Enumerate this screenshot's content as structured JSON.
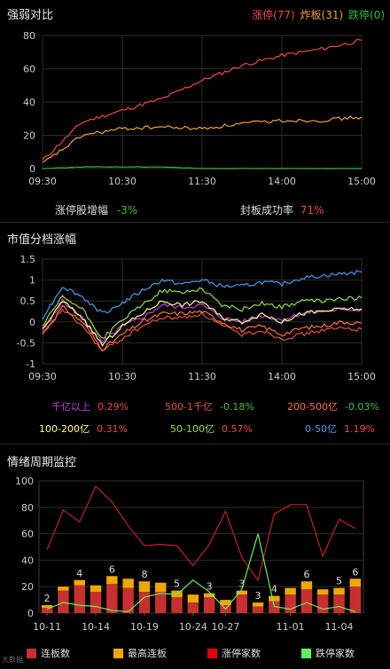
{
  "panel1": {
    "title": "强弱对比",
    "legend": {
      "limit_up": "涨停(77)",
      "bomb": "炸板(31)",
      "limit_down": "跌停(0)"
    },
    "yticks": [
      "80",
      "60",
      "40",
      "20",
      "0"
    ],
    "xticks": [
      "09:30",
      "10:30",
      "11:30",
      "14:00",
      "15:00"
    ],
    "stats": {
      "zt_label": "涨停股增幅",
      "zt_value": "-3%",
      "fb_label": "封板成功率",
      "fb_value": "71%"
    }
  },
  "panel2": {
    "title": "市值分档涨幅",
    "yticks": [
      "1.5",
      "1",
      "0.5",
      "0",
      "-0.5",
      "-1"
    ],
    "xticks": [
      "09:30",
      "10:30",
      "11:30",
      "14:00",
      "15:00"
    ],
    "captions": [
      {
        "label": "千亿以上",
        "value": "0.29%",
        "color": "#c040e0",
        "vcolor": "#f04848"
      },
      {
        "label": "500-1千亿",
        "value": "-0.18%",
        "color": "#e85040",
        "vcolor": "#40c040"
      },
      {
        "label": "200-500亿",
        "value": "-0.03%",
        "color": "#ff7040",
        "vcolor": "#40c040"
      },
      {
        "label": "100-200亿",
        "value": "0.31%",
        "color": "#ffff80",
        "vcolor": "#f04848"
      },
      {
        "label": "50-100亿",
        "value": "0.57%",
        "color": "#90e040",
        "vcolor": "#f04848"
      },
      {
        "label": "0-50亿",
        "value": "1.19%",
        "color": "#40a0f0",
        "vcolor": "#f04848"
      }
    ]
  },
  "panel3": {
    "title": "情绪周期监控",
    "yticks": [
      "100",
      "80",
      "60",
      "40",
      "20",
      "0"
    ],
    "xticks": [
      "10-11",
      "10-14",
      "10-19",
      "10-24",
      "10-27",
      "11-01",
      "11-04"
    ],
    "legend": {
      "lianban": "连板数",
      "max_lianban": "最高连板",
      "zt_count": "涨停家数",
      "dt_count": "跌停家数"
    },
    "watermark": "大数据"
  },
  "colors": {
    "red": "#f04848",
    "orange": "#f0a030",
    "green": "#30c030",
    "bar_red": "#c83030",
    "bar_yellow": "#f0a800",
    "legend_red": "#e00000",
    "legend_green": "#60f060"
  },
  "chart_data": [
    {
      "type": "line",
      "title": "强弱对比",
      "x": [
        "09:30",
        "10:00",
        "10:30",
        "11:00",
        "11:30",
        "13:30",
        "14:00",
        "14:30",
        "15:00"
      ],
      "ylim": [
        0,
        80
      ],
      "series": [
        {
          "name": "涨停",
          "values": [
            5,
            28,
            35,
            42,
            53,
            62,
            68,
            72,
            77
          ]
        },
        {
          "name": "炸板",
          "values": [
            3,
            20,
            24,
            25,
            24,
            27,
            29,
            29,
            31
          ]
        },
        {
          "name": "跌停",
          "values": [
            0,
            1,
            1,
            1,
            0,
            0,
            0,
            0,
            0
          ]
        }
      ]
    },
    {
      "type": "line",
      "title": "市值分档涨幅",
      "x": [
        "09:30",
        "09:45",
        "10:00",
        "10:15",
        "10:30",
        "10:45",
        "11:00",
        "11:15",
        "11:30",
        "13:15",
        "13:30",
        "13:45",
        "14:00",
        "14:15",
        "14:30",
        "14:45",
        "15:00"
      ],
      "ylim": [
        -1,
        1.5
      ],
      "series": [
        {
          "name": "千亿以上",
          "values": [
            -0.2,
            0.5,
            0.1,
            -0.5,
            -0.1,
            0.1,
            0.4,
            0.35,
            0.4,
            0.1,
            0.0,
            0.15,
            0.05,
            0.2,
            0.25,
            0.3,
            0.29
          ]
        },
        {
          "name": "500-1千亿",
          "values": [
            -0.3,
            0.3,
            -0.1,
            -0.7,
            -0.4,
            -0.1,
            0.1,
            0.1,
            0.2,
            -0.1,
            -0.3,
            -0.2,
            -0.4,
            -0.3,
            -0.2,
            -0.15,
            -0.18
          ]
        },
        {
          "name": "200-500亿",
          "values": [
            -0.3,
            0.35,
            0.0,
            -0.65,
            -0.3,
            0.0,
            0.2,
            0.2,
            0.25,
            0.0,
            -0.2,
            -0.1,
            -0.3,
            -0.15,
            -0.1,
            0.0,
            -0.03
          ]
        },
        {
          "name": "100-200亿",
          "values": [
            -0.2,
            0.5,
            0.1,
            -0.55,
            -0.1,
            0.2,
            0.5,
            0.4,
            0.5,
            0.1,
            0.0,
            0.2,
            0.0,
            0.2,
            0.25,
            0.3,
            0.31
          ]
        },
        {
          "name": "50-100亿",
          "values": [
            -0.1,
            0.6,
            0.3,
            -0.4,
            0.05,
            0.4,
            0.75,
            0.7,
            0.8,
            0.4,
            0.3,
            0.45,
            0.35,
            0.5,
            0.5,
            0.55,
            0.57
          ]
        },
        {
          "name": "0-50亿",
          "values": [
            0.1,
            0.85,
            0.6,
            0.2,
            0.45,
            0.75,
            1.0,
            0.9,
            1.0,
            0.85,
            0.85,
            0.95,
            0.9,
            1.05,
            1.1,
            1.15,
            1.19
          ]
        }
      ]
    },
    {
      "type": "bar",
      "title": "情绪周期监控",
      "categories": [
        "10-11",
        "10-12",
        "10-13",
        "10-14",
        "10-17",
        "10-18",
        "10-19",
        "10-20",
        "10-21",
        "10-24",
        "10-25",
        "10-26",
        "10-27",
        "10-28",
        "10-31",
        "11-01",
        "11-02",
        "11-03",
        "11-04",
        "11-07"
      ],
      "ylim": [
        0,
        100
      ],
      "series": [
        {
          "name": "连板数",
          "values": [
            4,
            17,
            21,
            16,
            22,
            19,
            16,
            16,
            12,
            8,
            12,
            6,
            14,
            5,
            9,
            14,
            18,
            14,
            14,
            20
          ]
        },
        {
          "name": "最高连板",
          "values": [
            2,
            3,
            4,
            5,
            6,
            7,
            8,
            7,
            5,
            6,
            3,
            4,
            3,
            3,
            4,
            5,
            6,
            4,
            5,
            6
          ]
        },
        {
          "name": "涨停家数",
          "values": [
            48,
            78,
            69,
            96,
            84,
            66,
            51,
            52,
            51,
            36,
            52,
            77,
            42,
            25,
            75,
            82,
            82,
            43,
            71,
            64
          ]
        },
        {
          "name": "跌停家数",
          "values": [
            3,
            8,
            6,
            5,
            2,
            1,
            12,
            15,
            14,
            25,
            16,
            3,
            18,
            60,
            5,
            3,
            8,
            3,
            5,
            1
          ]
        }
      ]
    }
  ]
}
